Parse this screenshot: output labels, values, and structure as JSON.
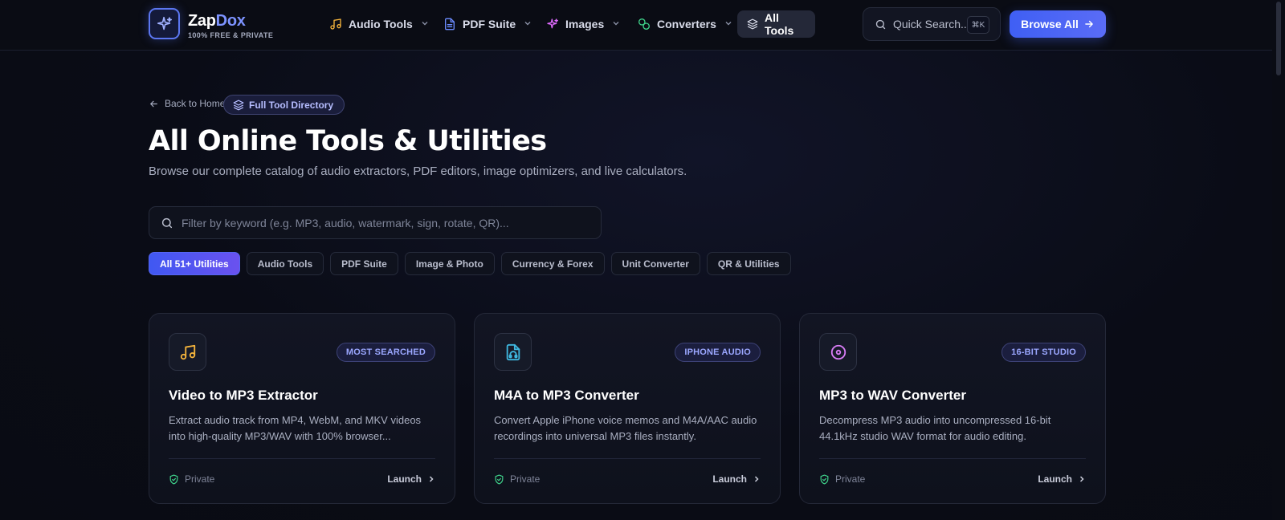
{
  "brand": {
    "name_part1": "Zap",
    "name_part2": "Dox",
    "tagline": "100% FREE & PRIVATE"
  },
  "nav": {
    "items": [
      {
        "label": "Audio Tools",
        "icon": "music-note-icon",
        "color": "#f5b43c"
      },
      {
        "label": "PDF Suite",
        "icon": "document-icon",
        "color": "#6c8cff"
      },
      {
        "label": "Images",
        "icon": "sparkles-icon",
        "color": "#e06bff"
      },
      {
        "label": "Converters",
        "icon": "coins-icon",
        "color": "#3fd28a"
      }
    ],
    "all_tools_label": "All Tools"
  },
  "header_search": {
    "placeholder": "Quick Search...",
    "shortcut": "⌘K"
  },
  "browse_button": {
    "label": "Browse All"
  },
  "page": {
    "back_label": "Back to Home",
    "directory_badge": "Full Tool Directory",
    "title": "All Online Tools & Utilities",
    "subtitle": "Browse our complete catalog of audio extractors, PDF editors, image optimizers, and live calculators."
  },
  "filter": {
    "placeholder": "Filter by keyword (e.g. MP3, audio, watermark, sign, rotate, QR)...",
    "value": ""
  },
  "chips": [
    {
      "label": "All 51+ Utilities",
      "active": true
    },
    {
      "label": "Audio Tools",
      "active": false
    },
    {
      "label": "PDF Suite",
      "active": false
    },
    {
      "label": "Image & Photo",
      "active": false
    },
    {
      "label": "Currency & Forex",
      "active": false
    },
    {
      "label": "Unit Converter",
      "active": false
    },
    {
      "label": "QR & Utilities",
      "active": false
    }
  ],
  "cards": [
    {
      "icon": "music-note-icon",
      "icon_color": "#f5b43c",
      "badge": "MOST SEARCHED",
      "title": "Video to MP3 Extractor",
      "description": "Extract audio track from MP4, WebM, and MKV videos into high-quality MP3/WAV with 100% browser...",
      "private_label": "Private",
      "launch_label": "Launch"
    },
    {
      "icon": "audio-file-icon",
      "icon_color": "#3fb8e0",
      "badge": "IPHONE AUDIO",
      "title": "M4A to MP3 Converter",
      "description": "Convert Apple iPhone voice memos and M4A/AAC audio recordings into universal MP3 files instantly.",
      "private_label": "Private",
      "launch_label": "Launch"
    },
    {
      "icon": "disc-icon",
      "icon_color": "#d77cf5",
      "badge": "16-BIT STUDIO",
      "title": "MP3 to WAV Converter",
      "description": "Decompress MP3 audio into uncompressed 16-bit 44.1kHz studio WAV format for audio editing.",
      "private_label": "Private",
      "launch_label": "Launch"
    }
  ],
  "colors": {
    "accent": "#4a63f3",
    "private_green": "#3fd28a"
  }
}
